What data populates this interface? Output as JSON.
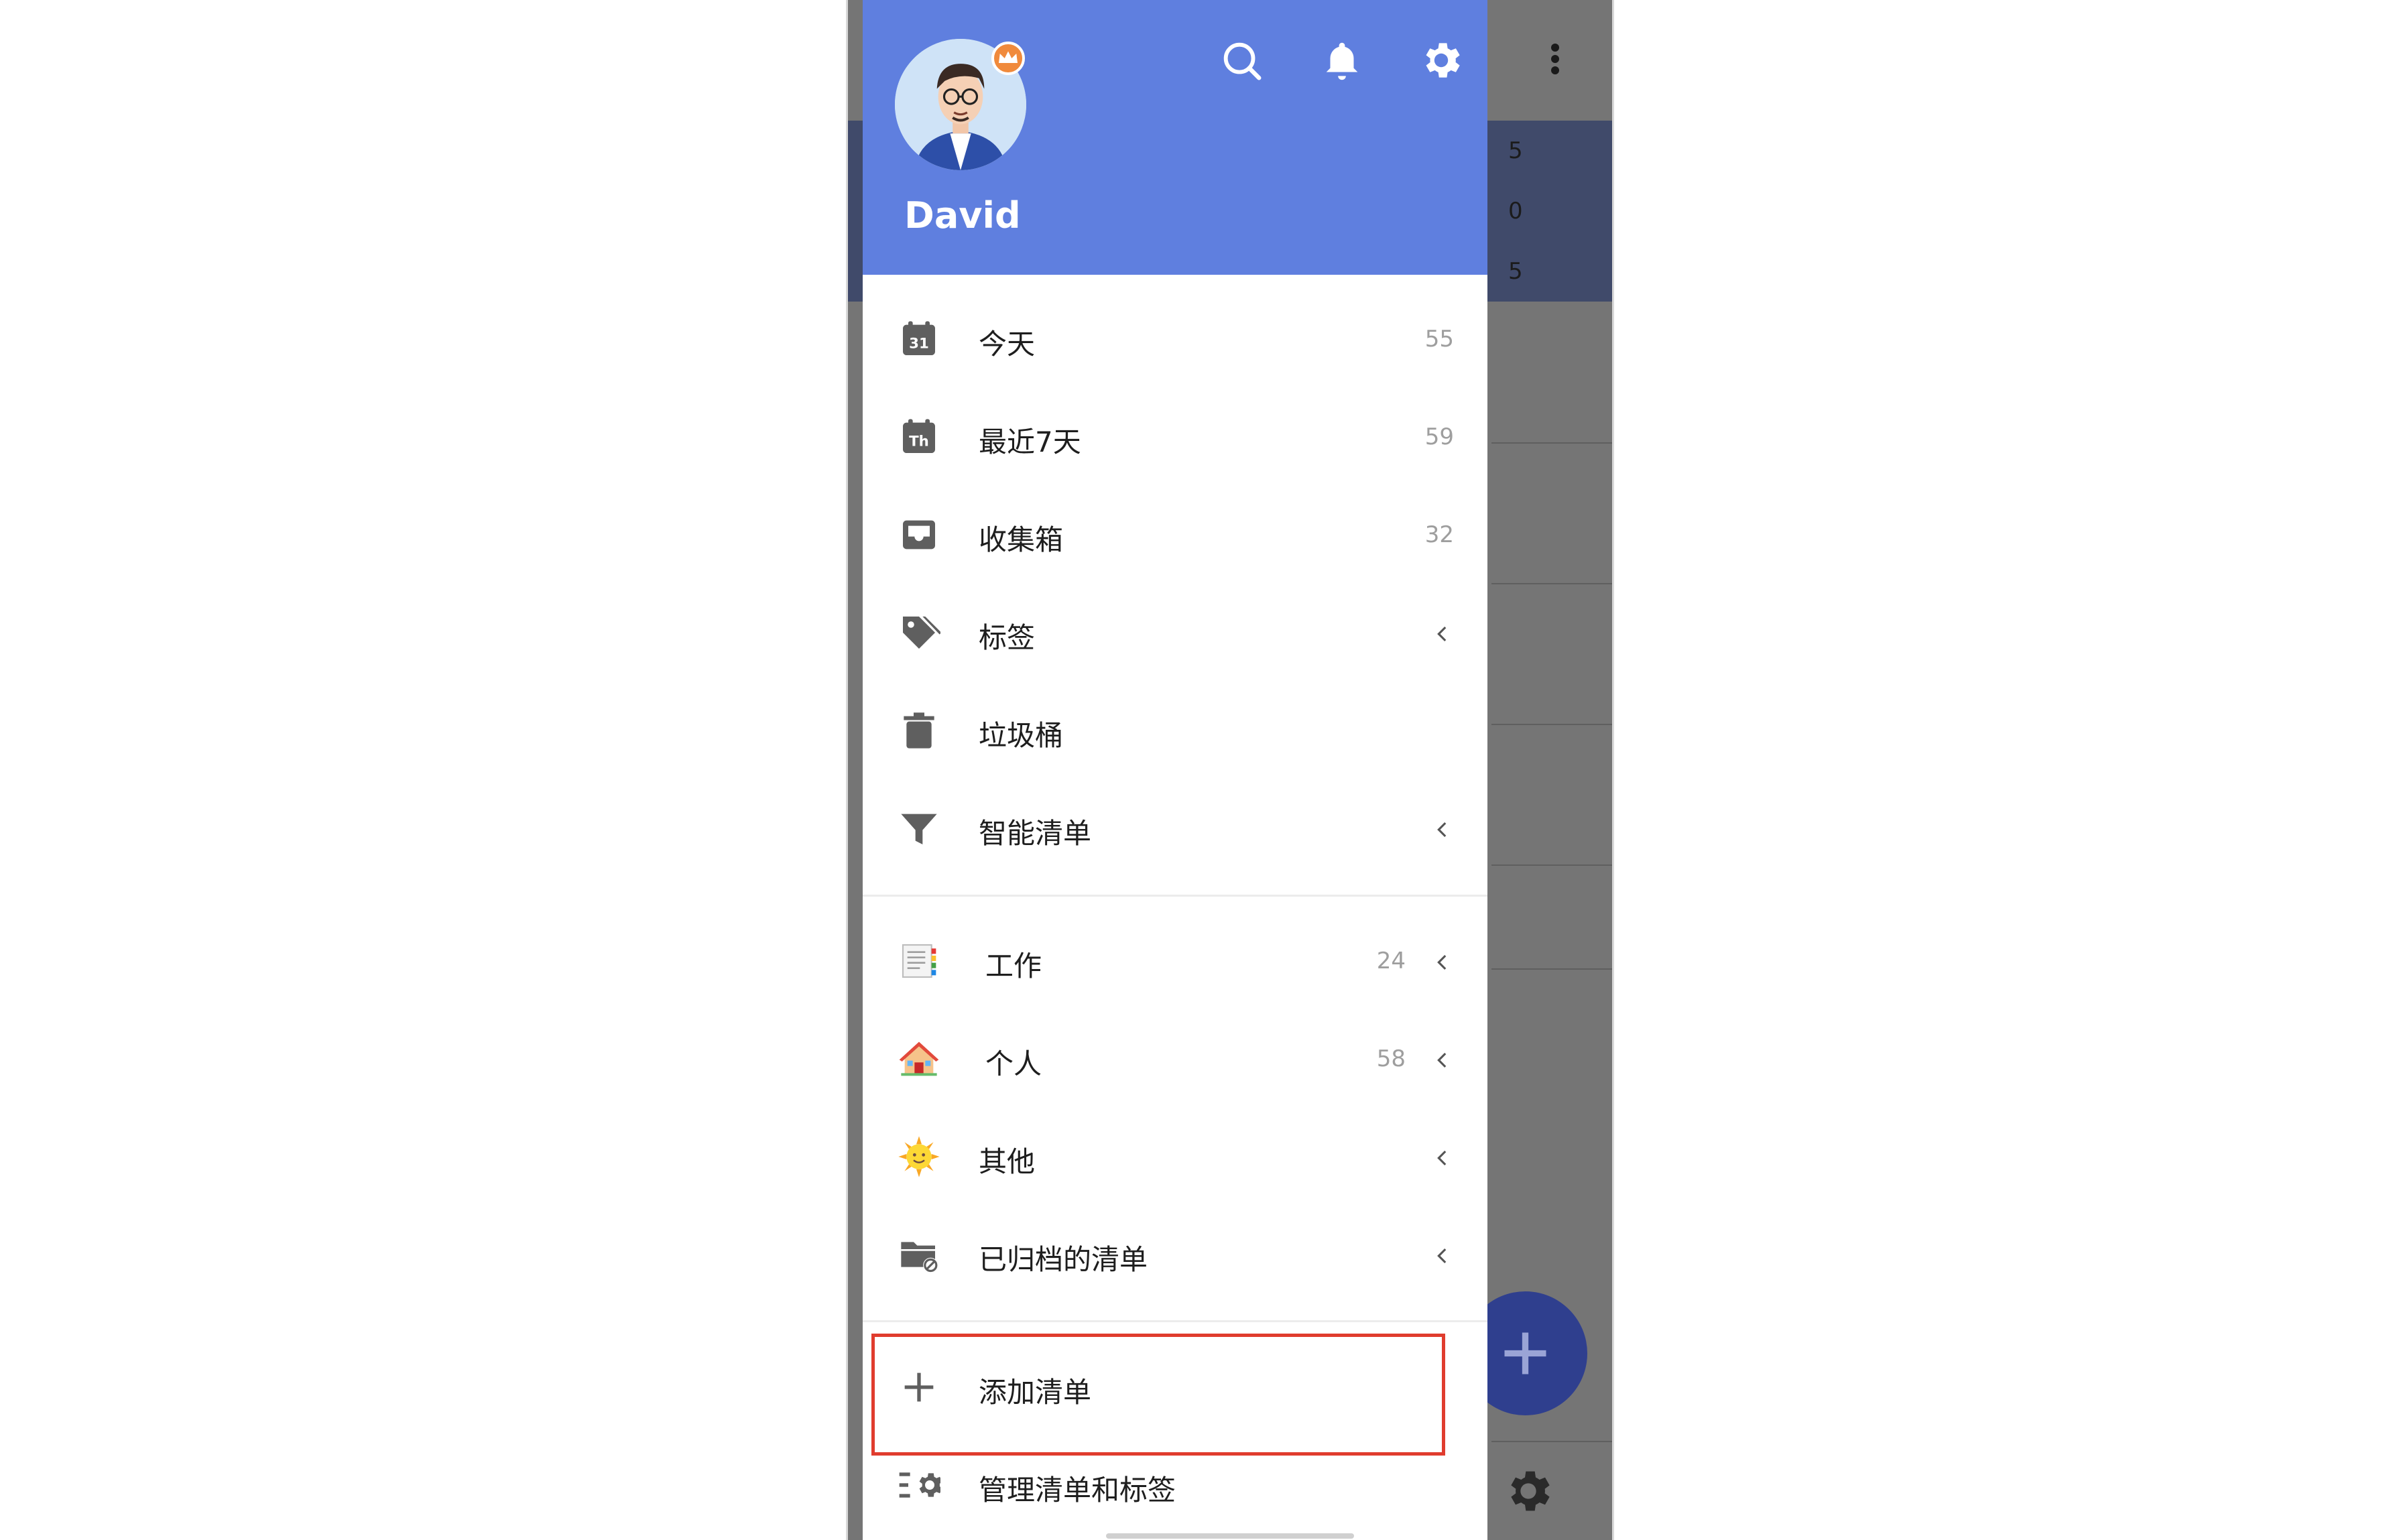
{
  "user": {
    "name": "David"
  },
  "drawer": {
    "nav_items": [
      {
        "label": "今天",
        "count": "55",
        "icon": "calendar-today-icon",
        "icon_text": "31"
      },
      {
        "label": "最近7天",
        "count": "59",
        "icon": "calendar-week-icon",
        "icon_text": "Th"
      },
      {
        "label": "收集箱",
        "count": "32",
        "icon": "inbox-icon"
      },
      {
        "label": "标签",
        "icon": "tag-icon"
      },
      {
        "label": "垃圾桶",
        "icon": "trash-icon"
      },
      {
        "label": "智能清单",
        "icon": "filter-icon"
      }
    ],
    "lists": [
      {
        "label": "工作",
        "count": "24",
        "icon": "notebook-emoji-icon"
      },
      {
        "label": "个人",
        "count": "58",
        "icon": "house-emoji-icon"
      },
      {
        "label": "其他",
        "icon": "sun-emoji-icon"
      },
      {
        "label": "已归档的清单",
        "icon": "archived-folder-icon"
      }
    ],
    "add_list_label": "添加清单",
    "manage_label": "管理清单和标签"
  },
  "background": {
    "visible_digits": [
      "5",
      "0",
      "5"
    ]
  },
  "colors": {
    "header_blue": "#5f7fdf",
    "highlight_red": "#e03c2e",
    "fab_blue": "#2f3f8e"
  }
}
